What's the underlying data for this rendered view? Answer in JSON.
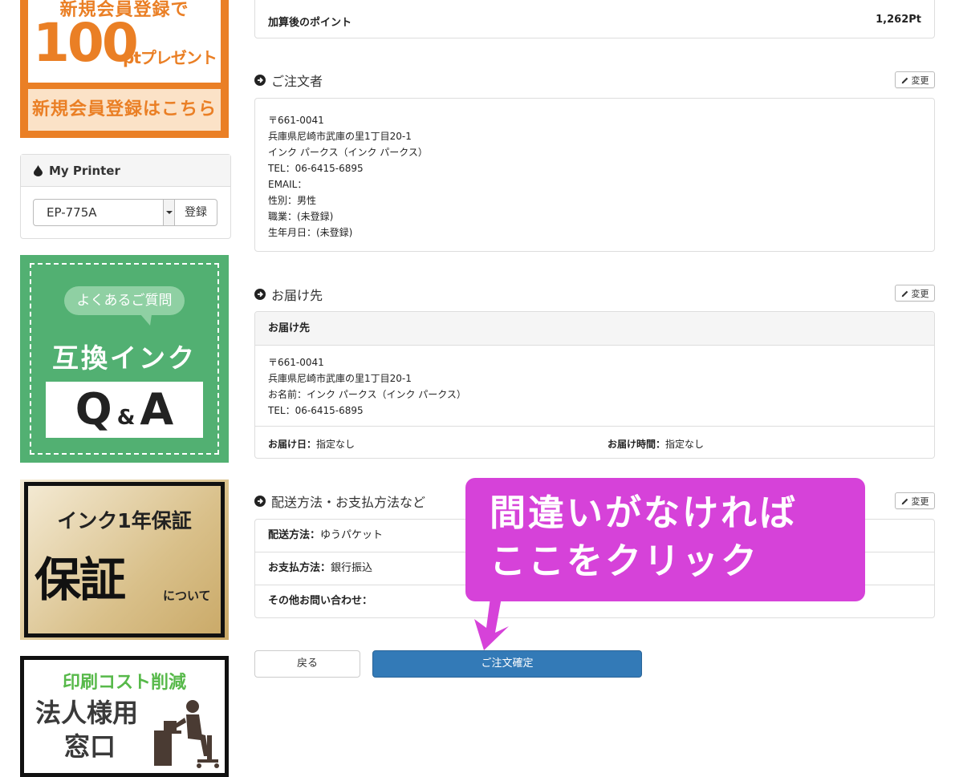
{
  "sidebar": {
    "member_banner": {
      "line1": "新規会員登録で",
      "amount": "100",
      "unit": "ptプレゼント",
      "cta": "新規会員登録はこちら"
    },
    "my_printer": {
      "title": "My Printer",
      "selected_model": "EP-775A",
      "register_label": "登録"
    },
    "qa_banner": {
      "bubble": "よくあるご質問",
      "title": "互換インク",
      "q": "Q",
      "amp": "&",
      "a": "A"
    },
    "warranty_banner": {
      "line1": "インク1年保証",
      "line2": "保証",
      "line3": "について"
    },
    "corporate_banner": {
      "line1": "印刷コスト削減",
      "line2": "法人様用",
      "line3": "窓口"
    }
  },
  "points": {
    "label": "加算後のポイント",
    "value": "1,262Pt"
  },
  "orderer": {
    "title": "ご注文者",
    "change_label": "変更",
    "postal": "〒661-0041",
    "address": "兵庫県尼崎市武庫の里1丁目20-1",
    "name": "インク パークス（インク パークス）",
    "tel": "TEL：06-6415-6895",
    "email": "EMAIL：",
    "gender": "性別：男性",
    "occupation": "職業：(未登録)",
    "birthday": "生年月日：(未登録)"
  },
  "delivery": {
    "title": "お届け先",
    "change_label": "変更",
    "panel_header": "お届け先",
    "postal": "〒661-0041",
    "address": "兵庫県尼崎市武庫の里1丁目20-1",
    "name": "お名前：インク パークス（インク パークス）",
    "tel": "TEL：06-6415-6895",
    "date_label": "お届け日：",
    "date_value": "指定なし",
    "time_label": "お届け時間：",
    "time_value": "指定なし"
  },
  "shipping": {
    "title": "配送方法・お支払方法など",
    "change_label": "変更",
    "method_label": "配送方法：",
    "method_value": "ゆうパケット",
    "payment_label": "お支払方法：",
    "payment_value": "銀行振込",
    "inquiry_label": "その他お問い合わせ："
  },
  "actions": {
    "back_label": "戻る",
    "confirm_label": "ご注文確定"
  },
  "callout": {
    "line1": "間違いがなければ",
    "line2": "ここをクリック"
  },
  "colors": {
    "primary": "#337ab7",
    "callout": "#d642d9",
    "member_banner": "#ea7f25",
    "qa_banner": "#52b072"
  }
}
